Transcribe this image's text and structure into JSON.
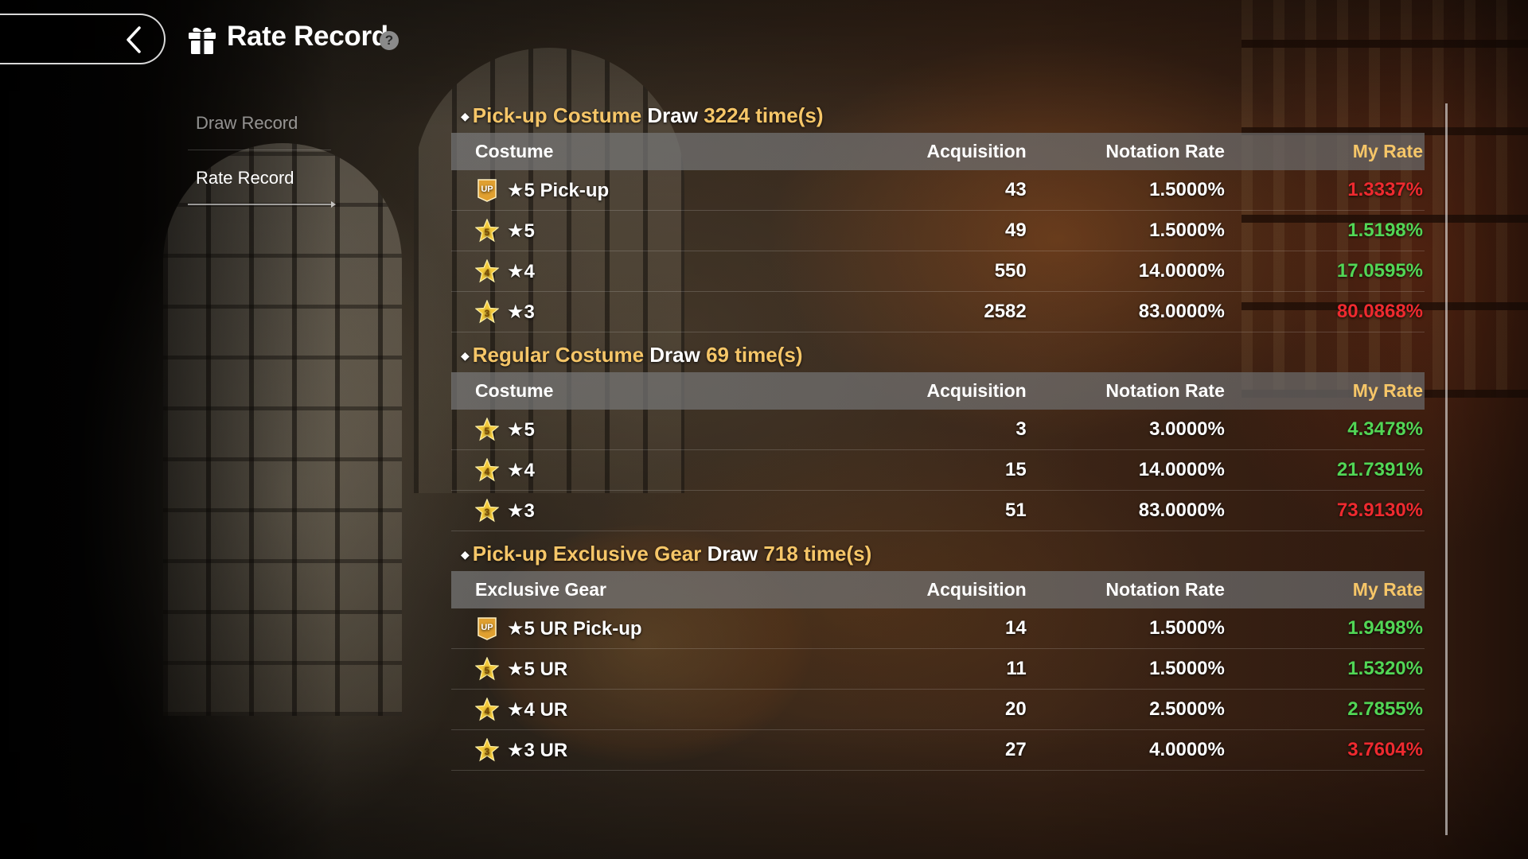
{
  "header": {
    "title": "Rate Record",
    "help_label": "?"
  },
  "nav": {
    "items": [
      {
        "label": "Draw Record",
        "active": false
      },
      {
        "label": "Rate Record",
        "active": true
      }
    ]
  },
  "sections": [
    {
      "name": "Pick-up Costume",
      "draw_word": "Draw",
      "count_text": "3224 time(s)",
      "columns": [
        "Costume",
        "Acquisition",
        "Notation Rate",
        "My Rate"
      ],
      "rows": [
        {
          "badge": "up-badge",
          "name": "★5 Pick-up",
          "acquisition": "43",
          "notation_rate": "1.5000%",
          "my_rate": "1.3337%",
          "status": "below"
        },
        {
          "badge": "star-5-badge",
          "name": "★5",
          "acquisition": "49",
          "notation_rate": "1.5000%",
          "my_rate": "1.5198%",
          "status": "above"
        },
        {
          "badge": "star-4-badge",
          "name": "★4",
          "acquisition": "550",
          "notation_rate": "14.0000%",
          "my_rate": "17.0595%",
          "status": "above"
        },
        {
          "badge": "star-3-badge",
          "name": "★3",
          "acquisition": "2582",
          "notation_rate": "83.0000%",
          "my_rate": "80.0868%",
          "status": "below"
        }
      ]
    },
    {
      "name": "Regular Costume",
      "draw_word": "Draw",
      "count_text": "69 time(s)",
      "columns": [
        "Costume",
        "Acquisition",
        "Notation Rate",
        "My Rate"
      ],
      "rows": [
        {
          "badge": "star-5-badge",
          "name": "★5",
          "acquisition": "3",
          "notation_rate": "3.0000%",
          "my_rate": "4.3478%",
          "status": "above"
        },
        {
          "badge": "star-4-badge",
          "name": "★4",
          "acquisition": "15",
          "notation_rate": "14.0000%",
          "my_rate": "21.7391%",
          "status": "above"
        },
        {
          "badge": "star-3-badge",
          "name": "★3",
          "acquisition": "51",
          "notation_rate": "83.0000%",
          "my_rate": "73.9130%",
          "status": "below"
        }
      ]
    },
    {
      "name": "Pick-up Exclusive Gear",
      "draw_word": "Draw",
      "count_text": "718 time(s)",
      "columns": [
        "Exclusive Gear",
        "Acquisition",
        "Notation Rate",
        "My Rate"
      ],
      "rows": [
        {
          "badge": "up-badge",
          "name": "★5 UR Pick-up",
          "acquisition": "14",
          "notation_rate": "1.5000%",
          "my_rate": "1.9498%",
          "status": "above"
        },
        {
          "badge": "star-5-badge",
          "name": "★5 UR",
          "acquisition": "11",
          "notation_rate": "1.5000%",
          "my_rate": "1.5320%",
          "status": "above"
        },
        {
          "badge": "star-4-badge",
          "name": "★4 UR",
          "acquisition": "20",
          "notation_rate": "2.5000%",
          "my_rate": "2.7855%",
          "status": "above"
        },
        {
          "badge": "star-3-badge",
          "name": "★3 UR",
          "acquisition": "27",
          "notation_rate": "4.0000%",
          "my_rate": "3.7604%",
          "status": "below"
        }
      ]
    }
  ],
  "colors": {
    "accent_gold": "#f6c668",
    "rate_above": "#52d655",
    "rate_below": "#ee2a2f"
  }
}
